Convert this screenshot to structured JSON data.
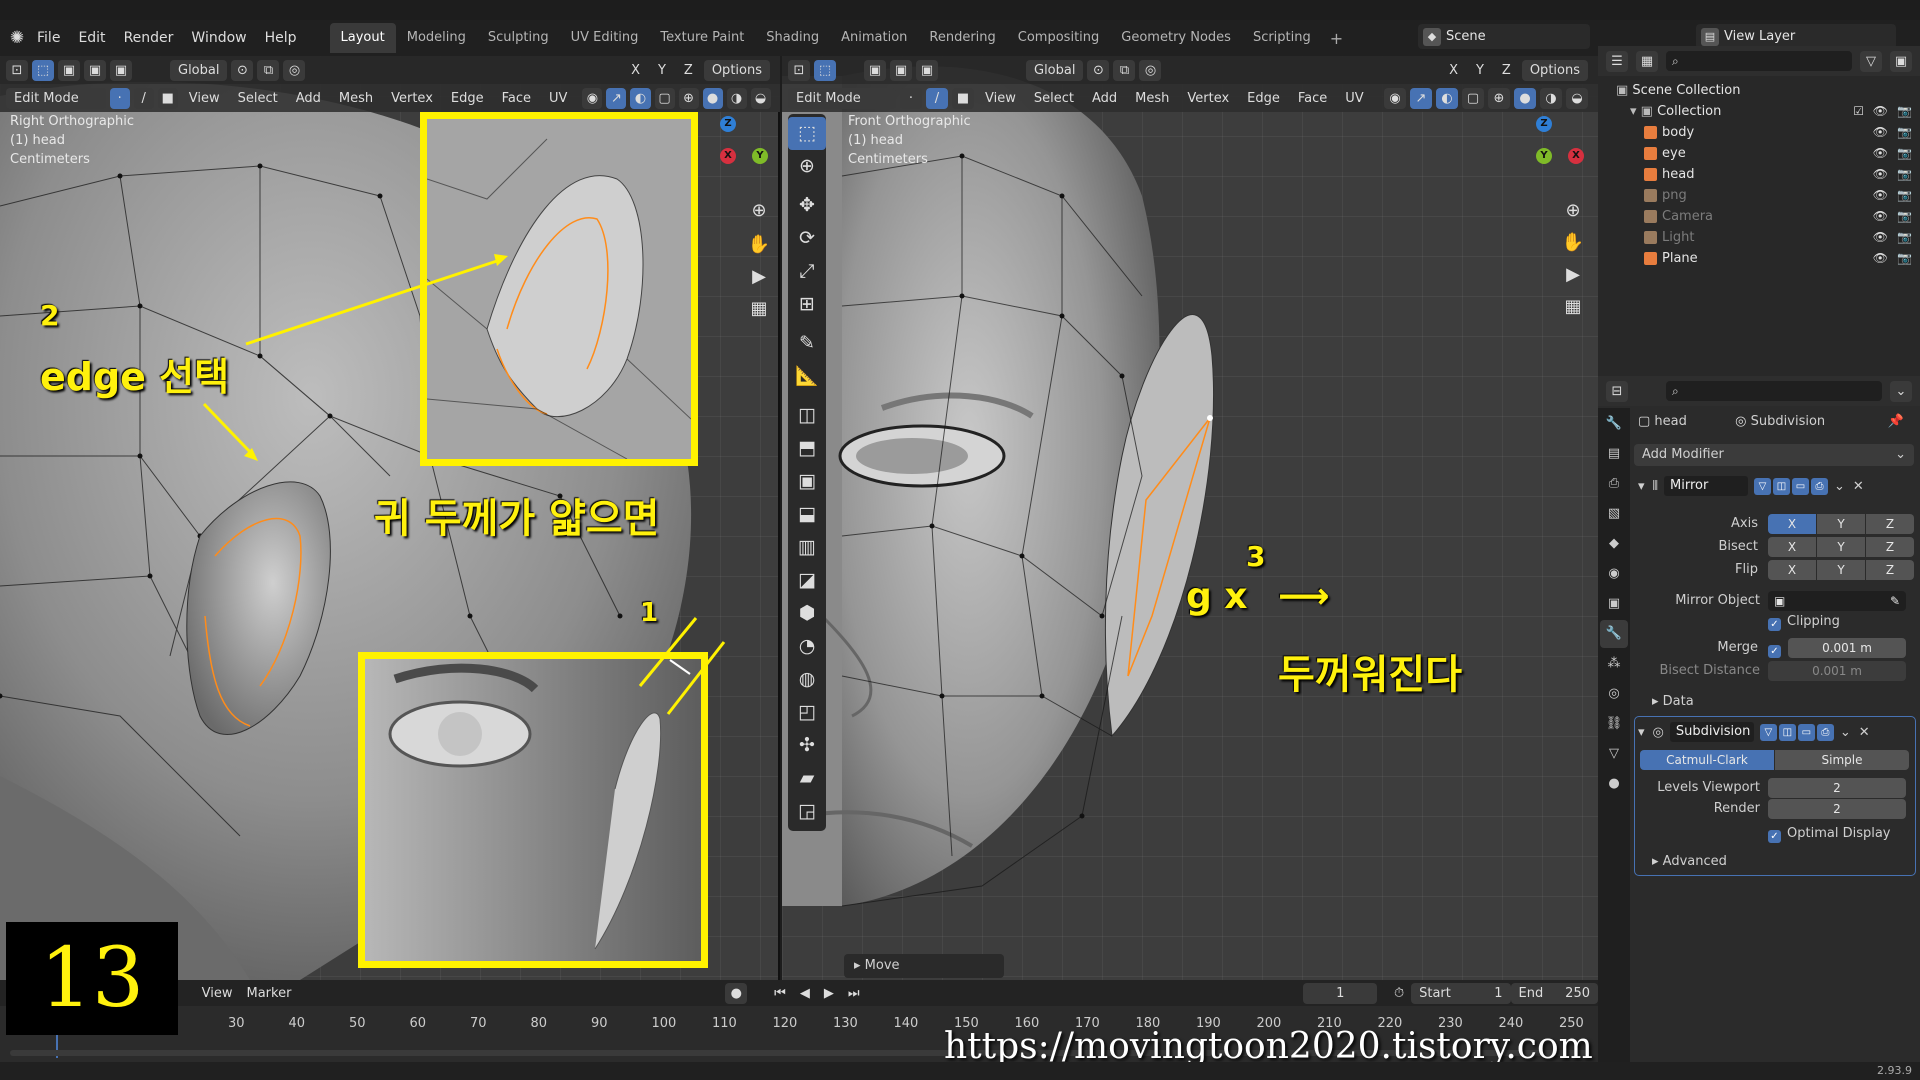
{
  "menubar": {
    "items": [
      "File",
      "Edit",
      "Render",
      "Window",
      "Help"
    ],
    "workspaces": [
      "Layout",
      "Modeling",
      "Sculpting",
      "UV Editing",
      "Texture Paint",
      "Shading",
      "Animation",
      "Rendering",
      "Compositing",
      "Geometry Nodes",
      "Scripting"
    ],
    "active_workspace": "Layout",
    "scene": "Scene",
    "view_layer": "View Layer"
  },
  "left_viewport": {
    "orientation": "Global",
    "options": "Options",
    "mode": "Edit Mode",
    "menus": [
      "View",
      "Select",
      "Add",
      "Mesh",
      "Vertex",
      "Edge",
      "Face",
      "UV"
    ],
    "axis_locks": [
      "X",
      "Y",
      "Z"
    ],
    "info": {
      "view": "Right Orthographic",
      "object": "(1) head",
      "units": "Centimeters"
    },
    "gizmo": {
      "top": "Z",
      "left": "X",
      "right": "Y"
    }
  },
  "right_viewport": {
    "orientation": "Global",
    "options": "Options",
    "mode": "Edit Mode",
    "menus": [
      "View",
      "Select",
      "Add",
      "Mesh",
      "Vertex",
      "Edge",
      "Face",
      "UV"
    ],
    "axis_locks": [
      "X",
      "Y",
      "Z"
    ],
    "info": {
      "view": "Front Orthographic",
      "object": "(1) head",
      "units": "Centimeters"
    },
    "gizmo": {
      "top": "Z",
      "center": "Y",
      "right": "X"
    },
    "last_operator": "Move"
  },
  "annotations": {
    "step2_number": "2",
    "step2_text": "edge 선택",
    "thin_ear_text": "귀 두께가 얇으면",
    "step1_number": "1",
    "step3_number": "3",
    "shortcut_text": "g  x",
    "arrow_text": "⟶",
    "thicker_text": "두꺼워진다",
    "step_counter": "13",
    "watermark": "https://movingtoon2020.tistory.com"
  },
  "timeline": {
    "menus": [
      "View",
      "Marker"
    ],
    "current_frame": "1",
    "start_label": "Start",
    "start_value": "1",
    "end_label": "End",
    "end_value": "250",
    "ticks": [
      "30",
      "40",
      "50",
      "60",
      "70",
      "80",
      "90",
      "100",
      "110",
      "120",
      "130",
      "140",
      "150",
      "160",
      "170",
      "180",
      "190",
      "200",
      "210",
      "220",
      "230",
      "240",
      "250"
    ]
  },
  "outliner": {
    "root": "Scene Collection",
    "collection": "Collection",
    "items": [
      {
        "name": "body",
        "icon_color": "#e87d3e",
        "dim": false
      },
      {
        "name": "eye",
        "icon_color": "#e87d3e",
        "dim": false
      },
      {
        "name": "head",
        "icon_color": "#e87d3e",
        "dim": false
      },
      {
        "name": "png",
        "icon_color": "#9a7b5e",
        "dim": true
      },
      {
        "name": "Camera",
        "icon_color": "#9a7b5e",
        "dim": true
      },
      {
        "name": "Light",
        "icon_color": "#9a7b5e",
        "dim": true
      },
      {
        "name": "Plane",
        "icon_color": "#e87d3e",
        "dim": false
      }
    ]
  },
  "properties": {
    "object_name": "head",
    "active_modifier": "Subdivision",
    "add_modifier": "Add Modifier",
    "mirror": {
      "name": "Mirror",
      "axis_label": "Axis",
      "bisect_label": "Bisect",
      "flip_label": "Flip",
      "axes": [
        "X",
        "Y",
        "Z"
      ],
      "mirror_object_label": "Mirror Object",
      "clipping_label": "Clipping",
      "merge_label": "Merge",
      "merge_value": "0.001 m",
      "bisect_distance_label": "Bisect Distance",
      "bisect_distance_value": "0.001 m",
      "data_label": "Data"
    },
    "subdivision": {
      "name": "Subdivision",
      "type_a": "Catmull-Clark",
      "type_b": "Simple",
      "levels_viewport_label": "Levels Viewport",
      "levels_viewport_value": "2",
      "render_label": "Render",
      "render_value": "2",
      "optimal_display_label": "Optimal Display",
      "advanced_label": "Advanced"
    }
  },
  "status": {
    "version": "2.93.9"
  },
  "colors": {
    "accent": "#4772b3",
    "annotation_yellow": "#fff200",
    "selection_orange": "#ff8c1a"
  }
}
